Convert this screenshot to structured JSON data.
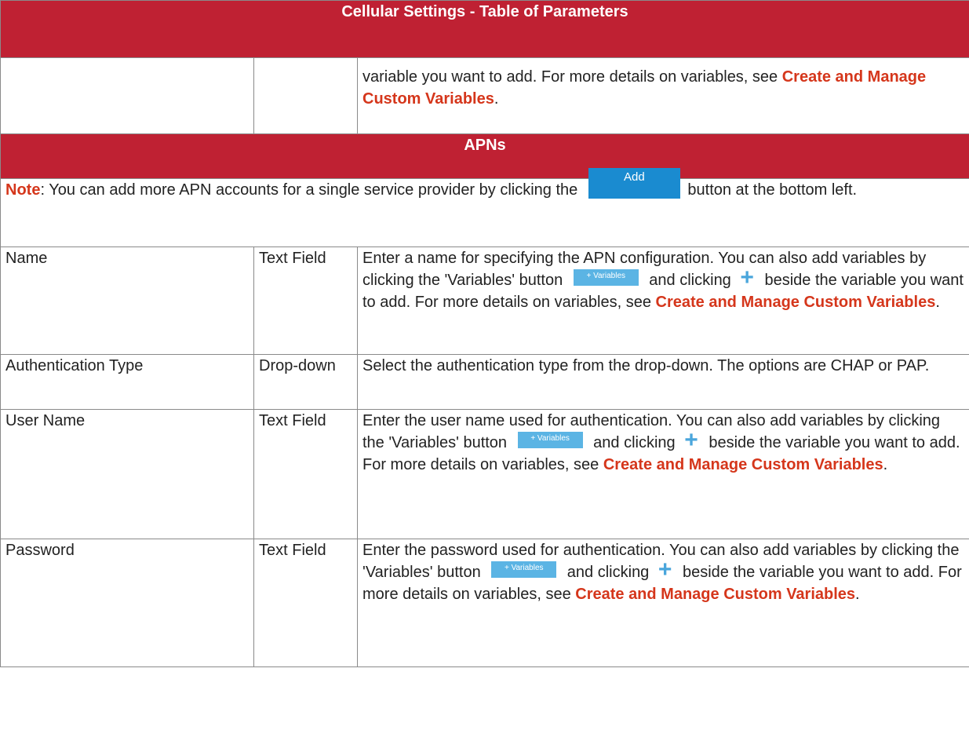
{
  "table": {
    "title": "Cellular Settings - Table of Parameters",
    "continued_row": {
      "parameter": "",
      "type": "",
      "desc_text": "variable you want to add. For more details on variables, see ",
      "link": "Create and Manage Custom Variables",
      "suffix": "."
    },
    "section_apns": "APNs",
    "note": {
      "label": "Note",
      "text_before": ": You can add more APN accounts for a single service provider by clicking the ",
      "button_label": "Add",
      "text_after": " button at the bottom left."
    },
    "rows": [
      {
        "parameter": "Name",
        "type": "Text Field",
        "desc_before": "Enter a name for specifying the APN configuration. You can also add variables by clicking the 'Variables' button ",
        "variables_button": "+ Variables",
        "desc_middle": " and clicking ",
        "desc_after": " beside the variable you want to add. For more details on variables, see ",
        "link": "Create and Manage Custom Variables",
        "suffix": "."
      },
      {
        "parameter": "Authentication Type",
        "type": "Drop-down",
        "desc": "Select the authentication type from the drop-down. The options are CHAP or PAP."
      },
      {
        "parameter": "User Name",
        "type": "Text Field",
        "desc_before": "Enter the user name used for authentication. You can also add variables by clicking the 'Variables' button ",
        "variables_button": "+ Variables",
        "desc_middle": " and clicking ",
        "desc_after": " beside the variable you want to add. For more details on variables, see ",
        "link": "Create and Manage Custom Variables",
        "suffix": "."
      },
      {
        "parameter": "Password",
        "type": "Text Field",
        "desc_before": "Enter the password used for authentication. You can also add variables by clicking the 'Variables' button ",
        "variables_button": "+ Variables",
        "desc_middle": " and clicking ",
        "desc_after": " beside the variable you want to add. For more details on variables, see ",
        "link": "Create and Manage Custom Variables",
        "suffix": "."
      }
    ]
  },
  "icons": {
    "plus": "plus-icon"
  },
  "colors": {
    "header_bg": "#bf2133",
    "link": "#d5361b",
    "add_button": "#1a8bd0",
    "variables_button": "#5bb4e4"
  }
}
